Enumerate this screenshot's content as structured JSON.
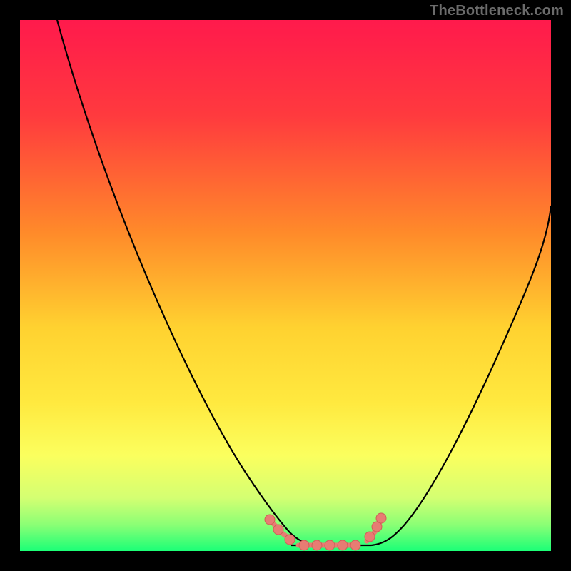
{
  "attribution": "TheBottleneck.com",
  "colors": {
    "gradient_top": "#ff1a4c",
    "gradient_upper_mid": "#ff7a2e",
    "gradient_mid": "#ffe138",
    "gradient_lower_mid": "#faff60",
    "gradient_low": "#c7ff7a",
    "gradient_bottom": "#1bff77",
    "curve": "#000000",
    "marker_fill": "#e77c73",
    "marker_stroke": "#cf5f57",
    "frame": "#000000"
  },
  "chart_data": {
    "type": "line",
    "title": "",
    "xlabel": "",
    "ylabel": "",
    "xlim": [
      0,
      100
    ],
    "ylim": [
      0,
      100
    ],
    "grid": false,
    "legend": false,
    "series": [
      {
        "name": "left-branch",
        "x": [
          7,
          10,
          15,
          20,
          25,
          30,
          35,
          40,
          43,
          46,
          49,
          52,
          55,
          58,
          60,
          62,
          64,
          66,
          68,
          70,
          72,
          74,
          76,
          78,
          80,
          82,
          84,
          86,
          88,
          90,
          92,
          94,
          96,
          98,
          100
        ],
        "y": [
          100,
          95,
          88,
          80,
          72,
          64,
          56,
          48,
          42,
          36,
          30,
          24,
          18,
          13,
          10,
          8,
          6,
          4,
          3,
          2,
          1.5,
          1.2,
          1.0,
          0.9,
          0.9,
          0.9,
          0.9,
          0.9,
          0.9,
          0.9,
          0.9,
          0.9,
          0.9,
          0.9,
          0.9
        ],
        "note": "descending curve from upper-left toward the flat valley"
      },
      {
        "name": "valley-flat",
        "x": [
          46,
          48,
          50,
          52,
          54,
          56,
          58,
          60,
          62,
          64,
          66,
          68
        ],
        "y": [
          0.9,
          0.9,
          0.9,
          0.9,
          0.9,
          0.9,
          0.9,
          0.9,
          0.9,
          0.9,
          0.9,
          0.9
        ],
        "note": "flat bottom of the curve"
      },
      {
        "name": "right-branch",
        "x": [
          68,
          70,
          73,
          76,
          79,
          82,
          85,
          88,
          91,
          94,
          97,
          100
        ],
        "y": [
          0.9,
          2,
          5,
          10,
          16,
          23,
          31,
          40,
          48,
          55,
          60,
          65
        ],
        "note": "ascending curve from valley toward upper-right"
      },
      {
        "name": "valley-markers",
        "kind": "scatter",
        "points": [
          {
            "x": 47,
            "y": 6
          },
          {
            "x": 49,
            "y": 3
          },
          {
            "x": 51,
            "y": 1.2
          },
          {
            "x": 54,
            "y": 0.9
          },
          {
            "x": 56,
            "y": 0.9
          },
          {
            "x": 58,
            "y": 0.9
          },
          {
            "x": 60,
            "y": 0.9
          },
          {
            "x": 62,
            "y": 0.9
          },
          {
            "x": 66,
            "y": 3
          },
          {
            "x": 67,
            "y": 5
          },
          {
            "x": 68,
            "y": 6.5
          }
        ],
        "note": "salmon/pink-red dots and short segments clustered at the valley"
      }
    ]
  }
}
